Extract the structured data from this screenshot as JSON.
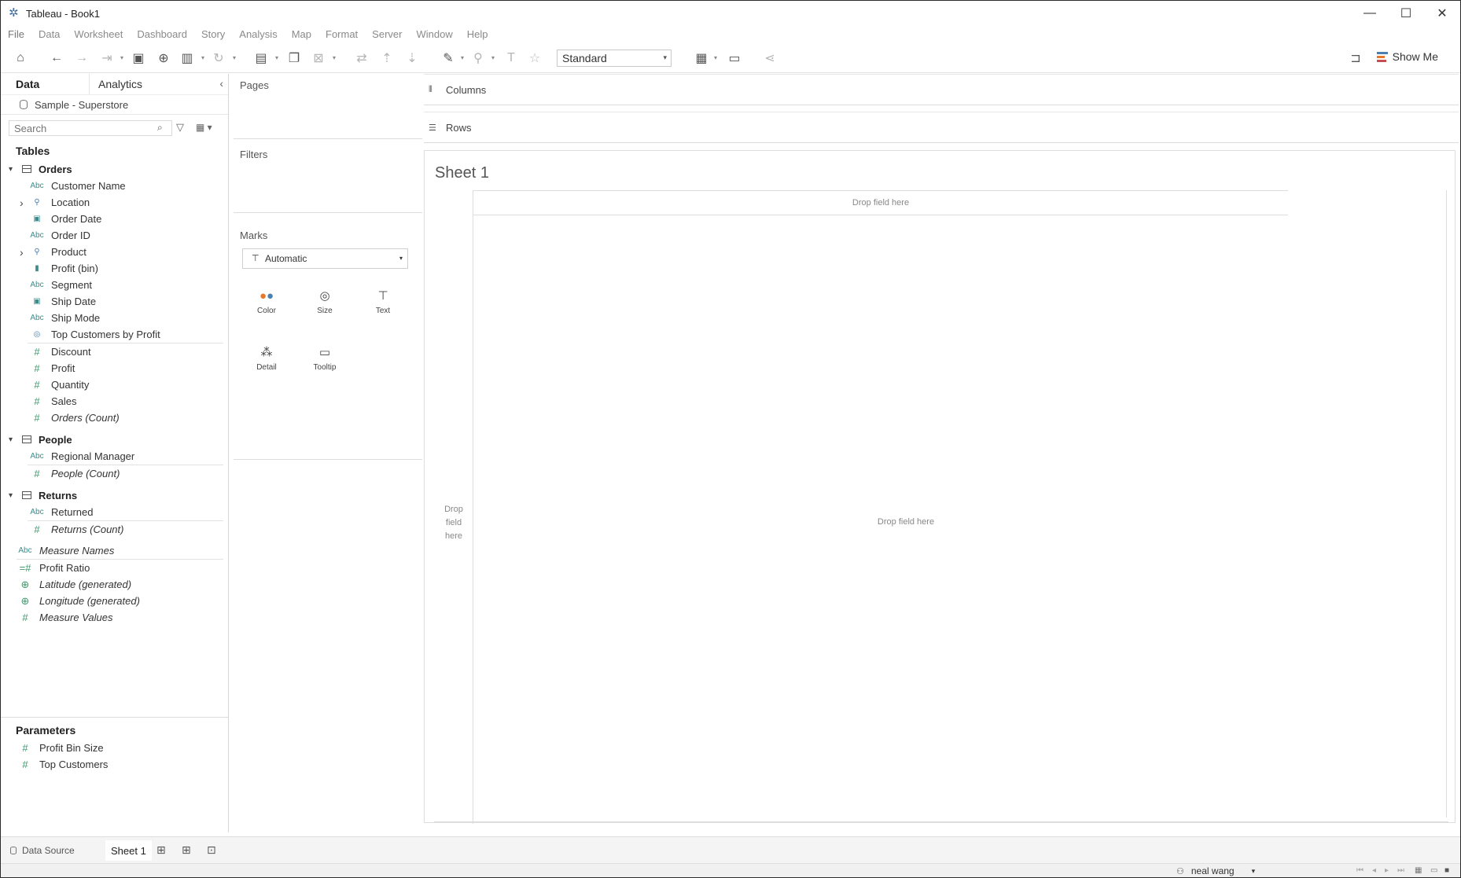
{
  "window": {
    "title": "Tableau - Book1",
    "controls": [
      "minimize",
      "maximize",
      "close"
    ]
  },
  "menubar": {
    "items": [
      "File",
      "Data",
      "Worksheet",
      "Dashboard",
      "Story",
      "Analysis",
      "Map",
      "Format",
      "Server",
      "Window",
      "Help"
    ]
  },
  "toolbar": {
    "fit_value": "Standard",
    "show_me_label": "Show Me"
  },
  "data_pane": {
    "tabs": [
      "Data",
      "Analytics"
    ],
    "datasource": "Sample - Superstore",
    "search_placeholder": "Search",
    "tables_heading": "Tables",
    "tables": [
      {
        "name": "Orders",
        "fields": [
          {
            "label": "Customer Name",
            "type": "Abc"
          },
          {
            "label": "Location",
            "type": "hierarchy",
            "expandable": true
          },
          {
            "label": "Order Date",
            "type": "date"
          },
          {
            "label": "Order ID",
            "type": "Abc"
          },
          {
            "label": "Product",
            "type": "hierarchy",
            "expandable": true
          },
          {
            "label": "Profit (bin)",
            "type": "bin"
          },
          {
            "label": "Segment",
            "type": "Abc"
          },
          {
            "label": "Ship Date",
            "type": "date"
          },
          {
            "label": "Ship Mode",
            "type": "Abc"
          },
          {
            "label": "Top Customers by Profit",
            "type": "set"
          },
          {
            "label": "Discount",
            "type": "#"
          },
          {
            "label": "Profit",
            "type": "#"
          },
          {
            "label": "Quantity",
            "type": "#"
          },
          {
            "label": "Sales",
            "type": "#"
          },
          {
            "label": "Orders (Count)",
            "type": "#",
            "italic": true
          }
        ]
      },
      {
        "name": "People",
        "fields": [
          {
            "label": "Regional Manager",
            "type": "Abc"
          },
          {
            "label": "People (Count)",
            "type": "#",
            "italic": true
          }
        ]
      },
      {
        "name": "Returns",
        "fields": [
          {
            "label": "Returned",
            "type": "Abc"
          },
          {
            "label": "Returns (Count)",
            "type": "#",
            "italic": true
          }
        ]
      }
    ],
    "extra_fields": [
      {
        "label": "Measure Names",
        "type": "Abc",
        "italic": true
      },
      {
        "label": "Profit Ratio",
        "type": "calc#"
      },
      {
        "label": "Latitude (generated)",
        "type": "geo",
        "italic": true
      },
      {
        "label": "Longitude (generated)",
        "type": "geo",
        "italic": true
      },
      {
        "label": "Measure Values",
        "type": "#",
        "italic": true
      }
    ],
    "parameters_heading": "Parameters",
    "parameters": [
      "Profit Bin Size",
      "Top Customers"
    ]
  },
  "cards": {
    "pages": "Pages",
    "filters": "Filters",
    "marks": "Marks",
    "mark_type": "Automatic",
    "mark_buttons": [
      "Color",
      "Size",
      "Text",
      "Detail",
      "Tooltip"
    ]
  },
  "shelves": {
    "columns": "Columns",
    "rows": "Rows"
  },
  "view": {
    "sheet_title": "Sheet 1",
    "drop_hint": "Drop field here",
    "row_drop_lines": [
      "Drop",
      "field",
      "here"
    ]
  },
  "bottom_tabs": {
    "data_source": "Data Source",
    "sheet": "Sheet 1"
  },
  "status": {
    "user": "neal wang"
  },
  "colors": {
    "measure_green": "#3c9a6c",
    "dimension_blue": "#4a7fb0",
    "accent": "#e8762c"
  }
}
